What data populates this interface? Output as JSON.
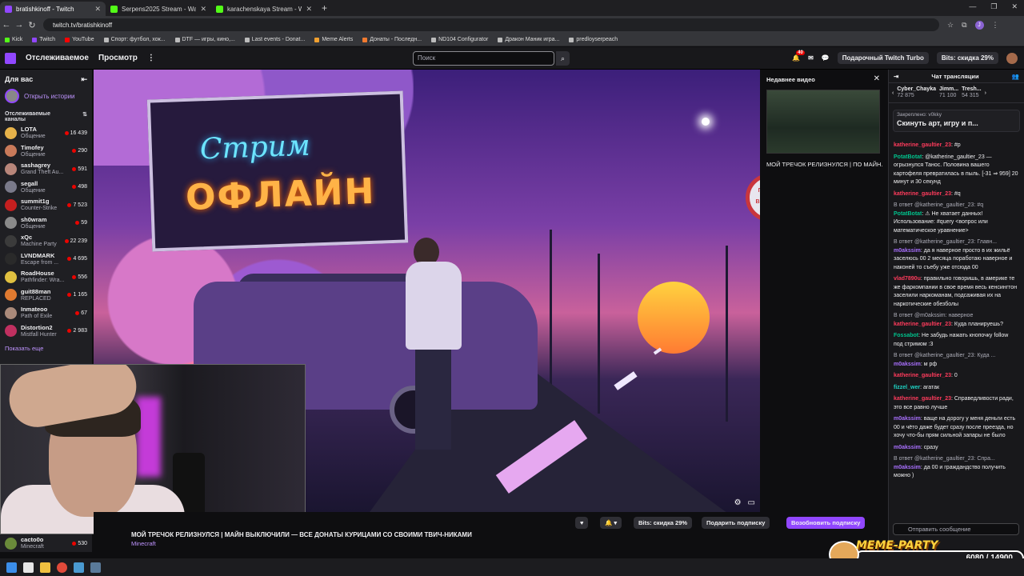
{
  "browser": {
    "tabs": [
      {
        "title": "bratishkinoff - Twitch",
        "active": true
      },
      {
        "title": "Serpens2025 Stream - Watch L",
        "active": false
      },
      {
        "title": "karachenskaya Stream - Watch",
        "active": false
      }
    ],
    "url": "twitch.tv/bratishkinoff",
    "bookmarks": [
      "Kick",
      "Twitch",
      "YouTube",
      "Спорт: футбол, хок...",
      "DTF — игры, кино,...",
      "Last events - Donat...",
      "Meme Alerts",
      "Донаты - Последн...",
      "ND104 Configurator",
      "Дракон Маник игра...",
      "predloyserpeach"
    ],
    "profile_initial": "J"
  },
  "twitch_nav": {
    "following": "Отслеживаемое",
    "browse": "Просмотр",
    "search_placeholder": "Поиск",
    "notif_count": "40",
    "turbo": "Подарочный Twitch Turbo",
    "bits": "Bits: скидка 29%"
  },
  "sidebar": {
    "for_you": "Для вас",
    "open_stories": "Открыть истории",
    "followed_title": "Отслеживаемые каналы",
    "channels": [
      {
        "name": "LOTA",
        "game": "Общение",
        "viewers": "16 439",
        "color": "#e6b24a"
      },
      {
        "name": "Timofey",
        "game": "Общение",
        "viewers": "290",
        "color": "#c97a5a"
      },
      {
        "name": "sashagrey",
        "game": "Grand Theft Au...",
        "viewers": "591",
        "color": "#b8867a"
      },
      {
        "name": "segall",
        "game": "Общение",
        "viewers": "498",
        "color": "#7a7a8a"
      },
      {
        "name": "summit1g",
        "game": "Counter-Strike",
        "viewers": "7 523",
        "color": "#c41f1f"
      },
      {
        "name": "sh0wram",
        "game": "Общение",
        "viewers": "59",
        "color": "#8a8a8a"
      },
      {
        "name": "xQc",
        "game": "Machine Party",
        "viewers": "22 239",
        "color": "#3b3b3b"
      },
      {
        "name": "LVNDMARK",
        "game": "Escape from ...",
        "viewers": "4 695",
        "color": "#2a2a2a"
      },
      {
        "name": "RoadHouse",
        "game": "Pathfinder: Wra...",
        "viewers": "556",
        "color": "#e0c040"
      },
      {
        "name": "guit88man",
        "game": "REPLACED",
        "viewers": "1 165",
        "color": "#e07a30"
      },
      {
        "name": "Inmateoo",
        "game": "Path of Exile",
        "viewers": "67",
        "color": "#aa8a7a"
      },
      {
        "name": "Distortion2",
        "game": "Mistfall Hunter",
        "viewers": "2 983",
        "color": "#c03060"
      }
    ],
    "show_more": "Показать еще",
    "bottom_channel": {
      "name": "cacto0o",
      "game": "Minecraft",
      "viewers": "530"
    }
  },
  "video": {
    "billboard_line1": "Стрим",
    "billboard_line2": "ОФЛАЙН",
    "sign_text_1": "ПЕРНАЧ",
    "sign_text_2": "ВЕРМАСН"
  },
  "recent_video": {
    "heading": "Недавнее видео",
    "title": "МОЙ ТРЕЧОК РЕЛИЗНУЛСЯ | ПО МАЙН..."
  },
  "info_bar": {
    "stream_title": "МОЙ ТРЕЧОК РЕЛИЗНУЛСЯ | МАЙН ВЫКЛЮЧИЛИ — ВСЕ ДОНАТЫ КУРИЦАМИ СО СВОИМИ ТВИЧ-НИКАМИ",
    "game": "Minecraft",
    "bits_btn": "Bits: скидка 29%",
    "gift_btn": "Подарить подписку",
    "resub_btn": "Возобновить подписку"
  },
  "chat": {
    "heading": "Чат трансляции",
    "leaders": [
      {
        "name": "Cyber_Chayka",
        "points": "72 875"
      },
      {
        "name": "Jimm...",
        "points": "71 100"
      },
      {
        "name": "Tresh...",
        "points": "54 315"
      }
    ],
    "pinned_label": "Закреплено: v0kky",
    "pinned_text": "Скинуть арт, игру и п...",
    "messages": [
      {
        "user": "katherine_gaultier_23",
        "cls": "u-red",
        "reply": "",
        "text": "#p"
      },
      {
        "user": "PotatBotat",
        "cls": "u-green",
        "reply": "",
        "text": "@katherine_gaultier_23 — огрызнулся Танос. Половина вашего картофеля превратилась в пыль. [-31 ⇒ 959] 20 минут и 30 секунд"
      },
      {
        "user": "katherine_gaultier_23",
        "cls": "u-red",
        "reply": "",
        "text": "#q"
      },
      {
        "user": "PotatBotat",
        "cls": "u-green",
        "reply": "В ответ @katherine_gaultier_23: #q",
        "text": "⚠ Не хватает данных! Использование: #query <вопрос или математическое уравнение>"
      },
      {
        "user": "m0akssim",
        "cls": "u-purple",
        "reply": "В ответ @katherine_gaultier_23: Главн...",
        "text": "да я наверное просто в их жильё заселюсь 00 2 месяца поработаю наверное и наконей то съебу уже отсюда 00"
      },
      {
        "user": "vlad7890u",
        "cls": "u-red",
        "reply": "",
        "text": "правильно говоришь, в америке те же фаркомпании в свое время весь кенсингтон заселили наркоманам, подсаживая их на наркотические обезболы"
      },
      {
        "user": "katherine_gaultier_23",
        "cls": "u-red",
        "reply": "В ответ @m0akssim: наверное",
        "text": "Куда планируешь?"
      },
      {
        "user": "Fossabot",
        "cls": "u-green",
        "reply": "",
        "text": "Не забудь нажать кнопочку follow под стримом :3"
      },
      {
        "user": "m0akssim",
        "cls": "u-purple",
        "reply": "В ответ @katherine_gaultier_23: Куда ...",
        "text": "м рф"
      },
      {
        "user": "katherine_gaultier_23",
        "cls": "u-red",
        "reply": "",
        "text": "0"
      },
      {
        "user": "fizzel_wer",
        "cls": "u-teal",
        "reply": "",
        "text": "агатак"
      },
      {
        "user": "katherine_gaultier_23",
        "cls": "u-red",
        "reply": "",
        "text": "Справедливости ради, это все равно лучше"
      },
      {
        "user": "m0akssim",
        "cls": "u-purple",
        "reply": "",
        "text": "ваще на дорогу у меня деньги есть 00 и чёто даже будет сразу после преезда, но хочу что-бы прям сильной запары не было"
      },
      {
        "user": "m0akssim",
        "cls": "u-purple",
        "reply": "",
        "text": "сразу"
      },
      {
        "user": "m0akssim",
        "cls": "u-purple",
        "reply": "В ответ @katherine_gaultier_23: Спра...",
        "text": "да 00 и граждандство получить можно )"
      }
    ],
    "input_placeholder": "Отправить сообщение"
  },
  "overlay": {
    "meme_tag": "MEME-PARTY",
    "meme_progress": "6080 / 14900"
  }
}
